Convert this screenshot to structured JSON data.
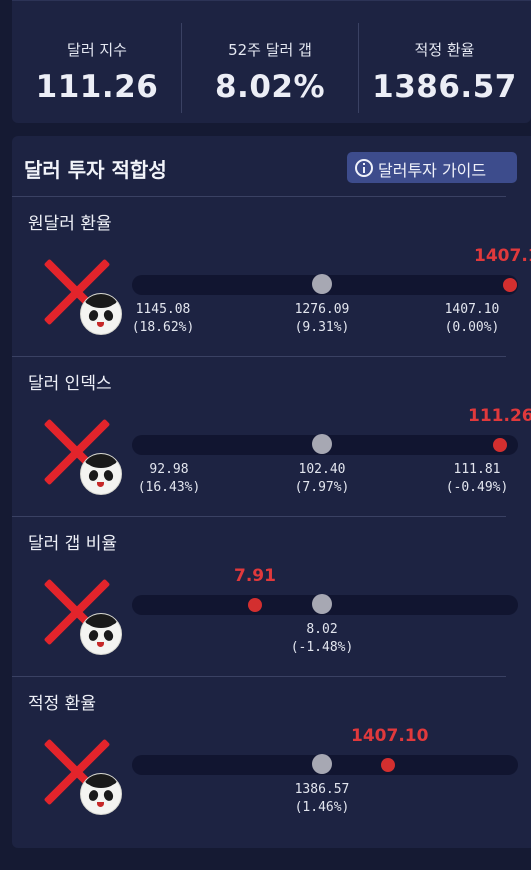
{
  "stats": [
    {
      "label": "달러 지수",
      "value": "111.26"
    },
    {
      "label": "52주 달러 갭",
      "value": "8.02%"
    },
    {
      "label": "적정 환율",
      "value": "1386.57"
    }
  ],
  "panel": {
    "title": "달러 투자 적합성",
    "guide_button": "달러투자 가이드"
  },
  "rows": [
    {
      "title": "원달러 환율",
      "current": "1407.1",
      "ticks": [
        {
          "value": "1145.08",
          "pct": "(18.62%)"
        },
        {
          "value": "1276.09",
          "pct": "(9.31%)"
        },
        {
          "value": "1407.10",
          "pct": "(0.00%)"
        }
      ]
    },
    {
      "title": "달러 인덱스",
      "current": "111.26",
      "ticks": [
        {
          "value": "92.98",
          "pct": "(16.43%)"
        },
        {
          "value": "102.40",
          "pct": "(7.97%)"
        },
        {
          "value": "111.81",
          "pct": "(-0.49%)"
        }
      ]
    },
    {
      "title": "달러 갭 비율",
      "current": "7.91",
      "ticks": [
        {
          "value": "8.02",
          "pct": "(-1.48%)"
        }
      ]
    },
    {
      "title": "적정 환율",
      "current": "1407.10",
      "ticks": [
        {
          "value": "1386.57",
          "pct": "(1.46%)"
        }
      ]
    }
  ],
  "colors": {
    "accent_red": "#d32f2f",
    "button_blue": "#3d4c8c",
    "background": "#151a33",
    "card": "#1d2342"
  },
  "icons": [
    "info-icon",
    "red-x-icon",
    "panda-avatar-icon"
  ]
}
